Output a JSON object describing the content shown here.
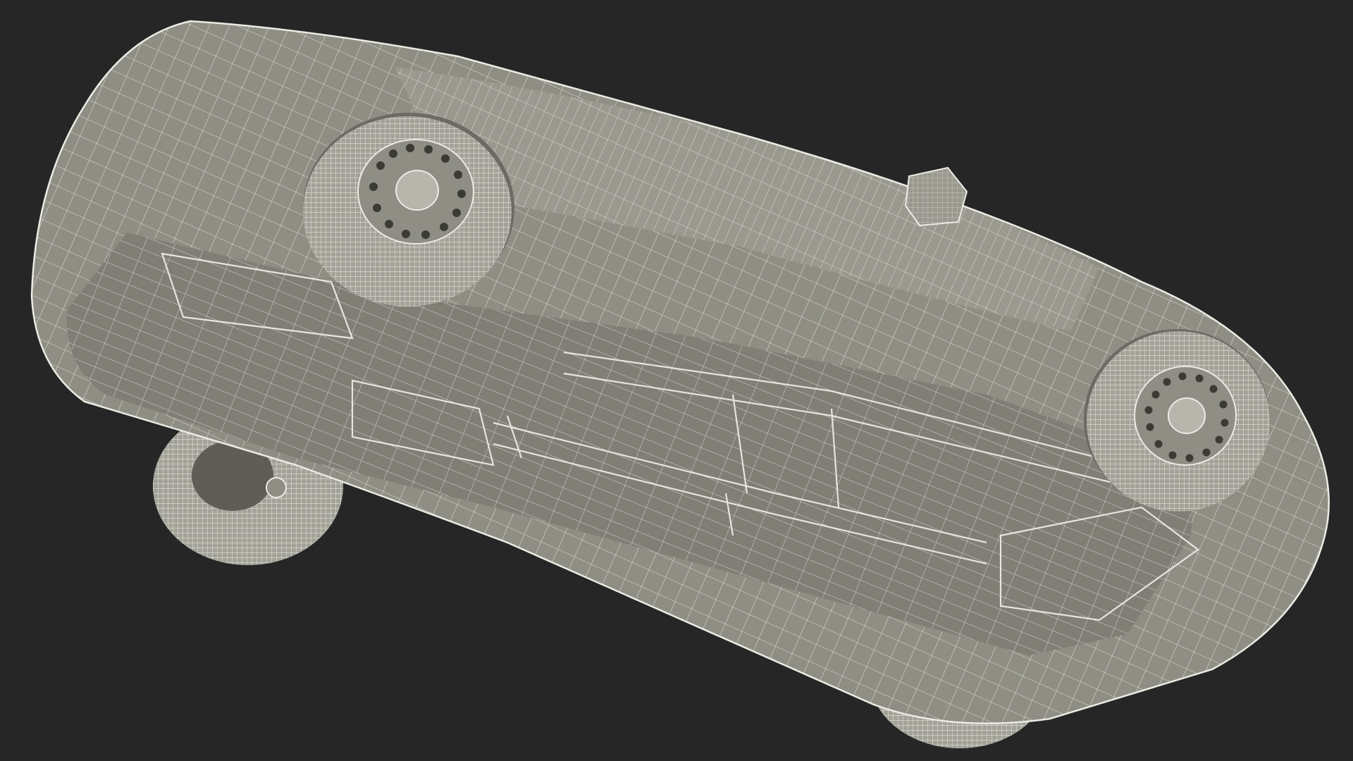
{
  "scene": {
    "subject": "car-wireframe-underside",
    "background_color": "#262626",
    "surface_color": "#8f8e84",
    "surface_shadow_color": "#6f6e66",
    "surface_highlight_color": "#a9a89e",
    "wire_color": "#ecebe3",
    "tire_color": "#a3a298",
    "wheel_count": 4
  }
}
